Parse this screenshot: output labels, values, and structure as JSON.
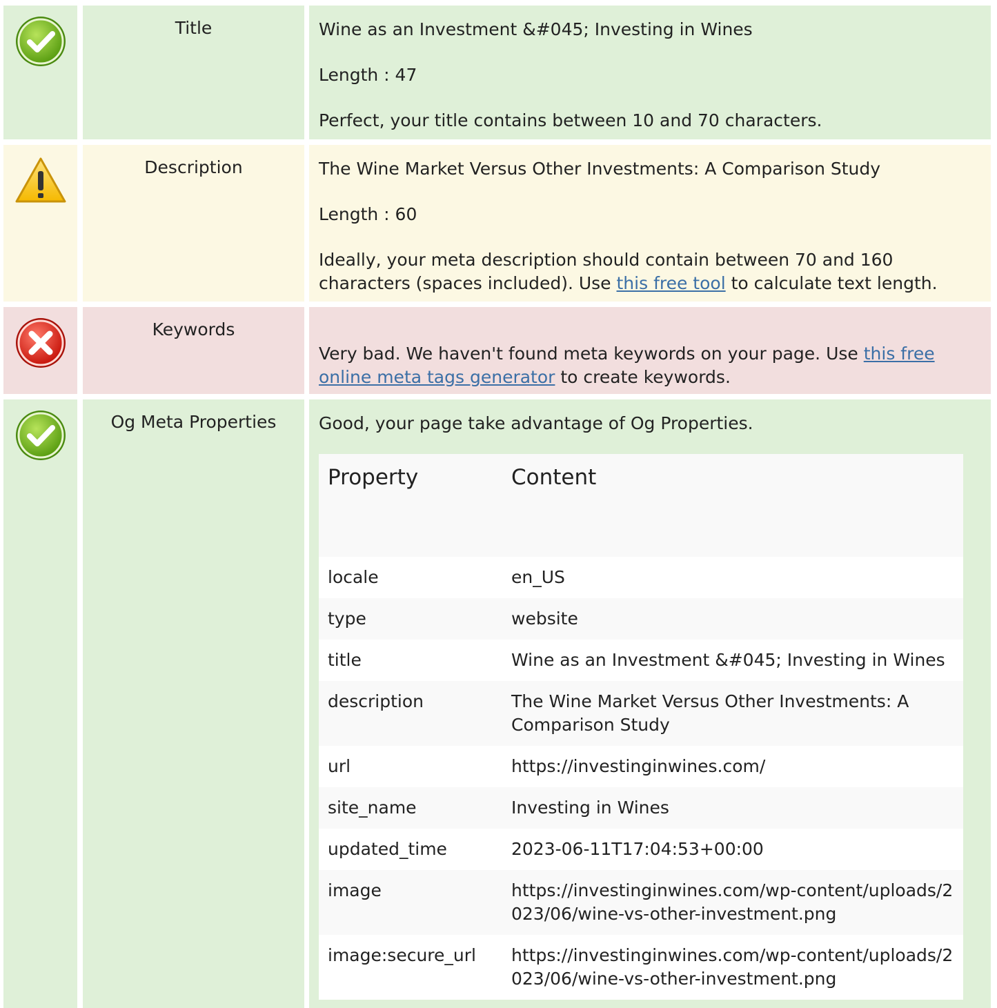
{
  "rows": {
    "title": {
      "label": "Title",
      "value": "Wine as an Investment &#045; Investing in Wines",
      "length": "Length : 47",
      "message": "Perfect, your title contains between 10 and 70 characters."
    },
    "description": {
      "label": "Description",
      "value": "The Wine Market Versus Other Investments: A Comparison Study",
      "length": "Length : 60",
      "message_pre": "Ideally, your meta description should contain between 70 and 160 characters (spaces included). Use ",
      "link": "this free tool",
      "message_post": " to calculate text length."
    },
    "keywords": {
      "label": "Keywords",
      "message_pre": "Very bad. We haven't found meta keywords on your page. Use ",
      "link": "this free online meta tags generator",
      "message_post": " to create keywords."
    },
    "og": {
      "label": "Og Meta Properties",
      "message": "Good, your page take advantage of Og Properties.",
      "table": {
        "headers": [
          "Property",
          "Content"
        ],
        "rows": [
          [
            "locale",
            "en_US"
          ],
          [
            "type",
            "website"
          ],
          [
            "title",
            "Wine as an Investment &#045; Investing in Wines"
          ],
          [
            "description",
            "The Wine Market Versus Other Investments: A Comparison Study"
          ],
          [
            "url",
            "https://investinginwines.com/"
          ],
          [
            "site_name",
            "Investing in Wines"
          ],
          [
            "updated_time",
            "2023-06-11T17:04:53+00:00"
          ],
          [
            "image",
            "https://investinginwines.com/wp-content/uploads/2023/06/wine-vs-other-investment.png"
          ],
          [
            "image:secure_url",
            "https://investinginwines.com/wp-content/uploads/2023/06/wine-vs-other-investment.png"
          ]
        ]
      }
    }
  },
  "icons": {
    "ok": "check-circle-icon",
    "warn": "warning-triangle-icon",
    "bad": "error-x-circle-icon"
  },
  "colors": {
    "ok_bg": "#dff0d8",
    "warn_bg": "#fcf8e3",
    "bad_bg": "#f2dede",
    "link": "#3b6fa6"
  }
}
